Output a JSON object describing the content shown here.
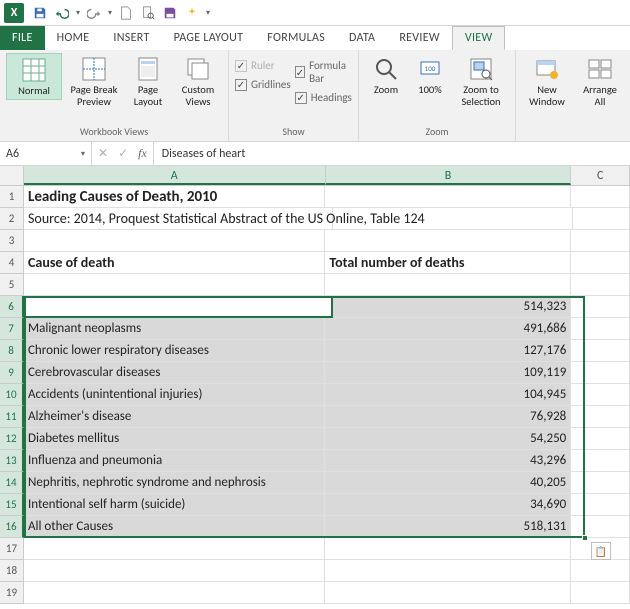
{
  "qat": {
    "app_letter": "X"
  },
  "tabs": {
    "file": "FILE",
    "home": "HOME",
    "insert": "INSERT",
    "pagelayout": "PAGE LAYOUT",
    "formulas": "FORMULAS",
    "data": "DATA",
    "review": "REVIEW",
    "view": "VIEW"
  },
  "ribbon": {
    "workbook_views": {
      "normal": "Normal",
      "page_break": "Page Break\nPreview",
      "page_layout": "Page\nLayout",
      "custom_views": "Custom\nViews",
      "label": "Workbook Views"
    },
    "show": {
      "ruler": "Ruler",
      "formula_bar": "Formula Bar",
      "gridlines": "Gridlines",
      "headings": "Headings",
      "label": "Show"
    },
    "zoom": {
      "zoom": "Zoom",
      "hundred": "100%",
      "zoom_to_sel": "Zoom to\nSelection",
      "label": "Zoom"
    },
    "window": {
      "new_window": "New\nWindow",
      "arrange_all": "Arrange\nAll"
    }
  },
  "namebox": "A6",
  "formula_content": "Diseases of heart",
  "columns": [
    "A",
    "B",
    "C"
  ],
  "title": "Leading Causes of Death, 2010",
  "source": "Source: 2014, Proquest Statistical Abstract of the US Online, Table 124",
  "headers": {
    "a": "Cause of death",
    "b": "Total number of deaths"
  },
  "rows": [
    {
      "cause": "Diseases of heart",
      "deaths": "514,323"
    },
    {
      "cause": "Malignant neoplasms",
      "deaths": "491,686"
    },
    {
      "cause": "Chronic lower respiratory diseases",
      "deaths": "127,176"
    },
    {
      "cause": "Cerebrovascular diseases",
      "deaths": "109,119"
    },
    {
      "cause": "Accidents (unintentional injuries)",
      "deaths": "104,945"
    },
    {
      "cause": "Alzheimer's disease",
      "deaths": "76,928"
    },
    {
      "cause": "Diabetes mellitus",
      "deaths": "54,250"
    },
    {
      "cause": "Influenza and pneumonia",
      "deaths": "43,296"
    },
    {
      "cause": "Nephritis, nephrotic syndrome and nephrosis",
      "deaths": "40,205"
    },
    {
      "cause": "Intentional self harm (suicide)",
      "deaths": "34,690"
    },
    {
      "cause": "All other Causes",
      "deaths": "518,131"
    }
  ],
  "chart_data": {
    "type": "table",
    "title": "Leading Causes of Death, 2010",
    "columns": [
      "Cause of death",
      "Total number of deaths"
    ],
    "data": [
      [
        "Diseases of heart",
        514323
      ],
      [
        "Malignant neoplasms",
        491686
      ],
      [
        "Chronic lower respiratory diseases",
        127176
      ],
      [
        "Cerebrovascular diseases",
        109119
      ],
      [
        "Accidents (unintentional injuries)",
        104945
      ],
      [
        "Alzheimer's disease",
        76928
      ],
      [
        "Diabetes mellitus",
        54250
      ],
      [
        "Influenza and pneumonia",
        43296
      ],
      [
        "Nephritis, nephrotic syndrome and nephrosis",
        40205
      ],
      [
        "Intentional self harm (suicide)",
        34690
      ],
      [
        "All other Causes",
        518131
      ]
    ]
  }
}
